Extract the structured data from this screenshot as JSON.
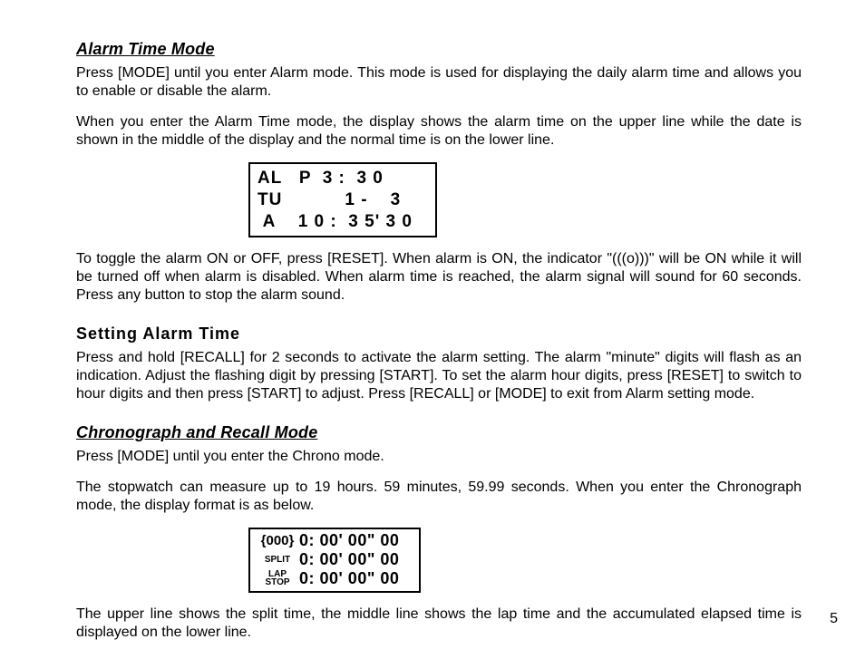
{
  "page_number": "5",
  "section1": {
    "heading": "Alarm Time Mode",
    "p1": "Press [MODE] until you enter Alarm mode.  This mode is used for displaying the daily alarm time and allows you to enable or disable the alarm.",
    "p2": "When you enter the Alarm Time mode, the display shows the alarm time on the upper line while the date is shown in the middle of the display and the normal time is on the lower line.",
    "lcd": "AL   P  3 :  3 0\nTU           1 -    3\n A    1 0 :  3 5' 3 0",
    "p3": "To toggle the alarm ON or OFF, press [RESET].  When alarm is ON, the indicator \"(((o)))\" will be ON while it will be turned off when alarm is disabled.  When alarm time is reached, the alarm signal will sound for 60 seconds. Press any button to stop the alarm sound."
  },
  "section2": {
    "heading": "Setting  Alarm  Time",
    "p1": "Press and hold [RECALL] for 2 seconds to activate the alarm setting. The alarm \"minute\" digits will flash as an indication. Adjust the flashing digit by pressing [START].  To set the alarm hour digits, press [RESET] to switch to hour digits and then press [START] to adjust. Press [RECALL] or [MODE] to exit from Alarm setting mode."
  },
  "section3": {
    "heading": "Chronograph and Recall Mode",
    "p1": "Press [MODE] until you enter the Chrono mode.",
    "p2": "The stopwatch can measure up to 19 hours. 59 minutes, 59.99 seconds. When you enter the Chronograph mode, the display format is as below.",
    "lcd": {
      "row1_side": "{000}",
      "row1_time": "0: 00' 00\" 00",
      "row2_side": "SPLIT",
      "row2_time": "0: 00' 00\" 00",
      "row3_side_a": "LAP",
      "row3_side_b": "STOP",
      "row3_time": "0: 00' 00\" 00"
    },
    "p3": "The upper line shows the split time, the middle line shows the lap time and the accumulated elapsed time is displayed on the lower line."
  }
}
